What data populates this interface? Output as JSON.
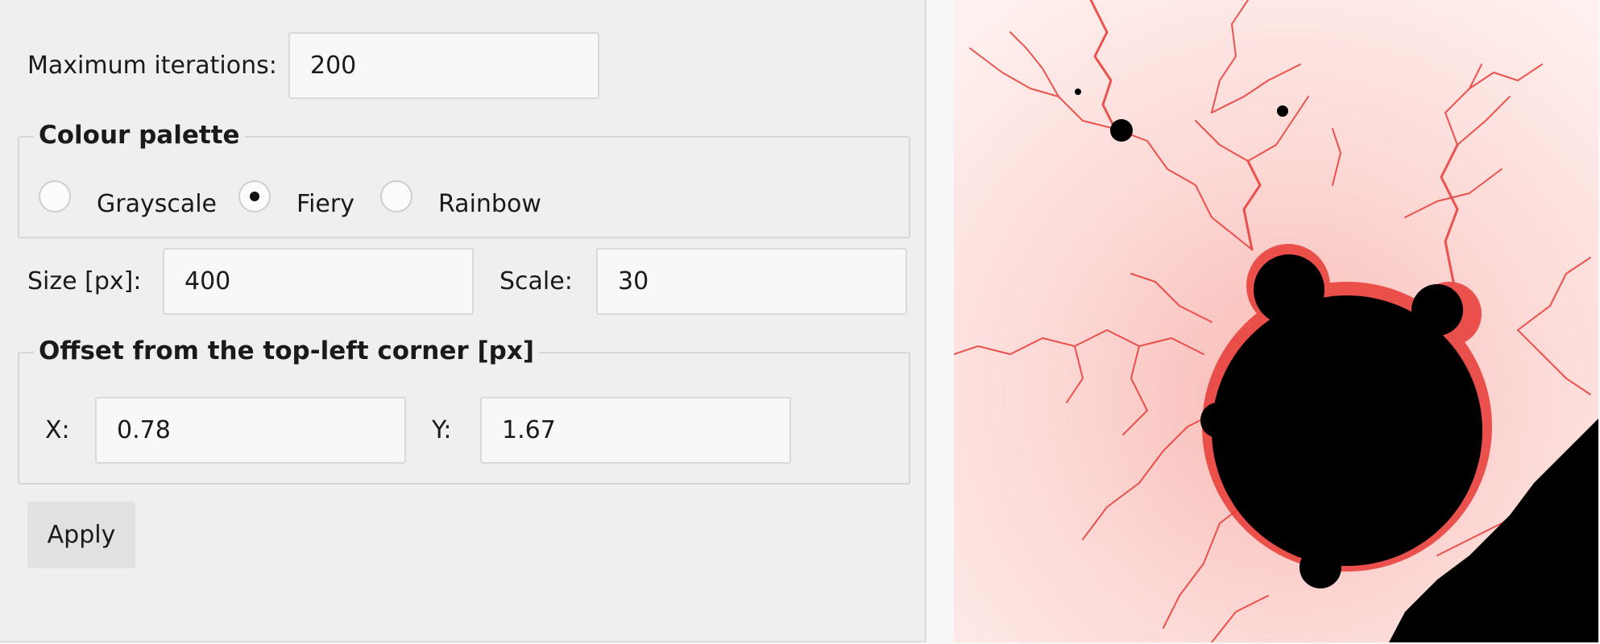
{
  "form": {
    "max_iterations_label": "Maximum iterations:",
    "max_iterations_value": "200",
    "palette_legend": "Colour palette",
    "palette_options": [
      {
        "label": "Grayscale",
        "selected": false
      },
      {
        "label": "Fiery",
        "selected": true
      },
      {
        "label": "Rainbow",
        "selected": false
      }
    ],
    "size_label": "Size [px]:",
    "size_value": "400",
    "scale_label": "Scale:",
    "scale_value": "30",
    "offset_legend": "Offset from the top-left corner [px]",
    "x_label": "X:",
    "x_value": "0.78",
    "y_label": "Y:",
    "y_value": "1.67",
    "apply_label": "Apply"
  },
  "render": {
    "palette": "fiery",
    "colors": {
      "background": "#fde8e6",
      "filament": "#e83a35",
      "set": "#000000"
    }
  }
}
